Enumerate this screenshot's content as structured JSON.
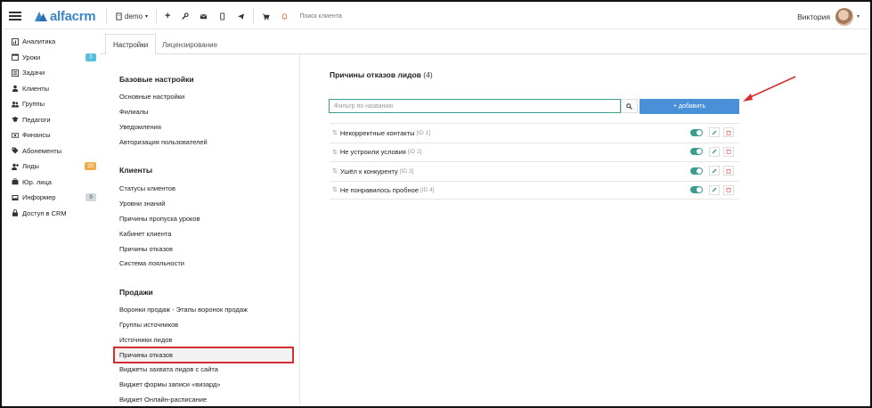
{
  "topbar": {
    "logo_text": "alfacrm",
    "branch_label": "demo",
    "search_placeholder": "Поиск клиента",
    "user_name": "Виктория",
    "colors": {
      "brand": "#3a86c8",
      "bell": "#e8674b"
    }
  },
  "sidebar": {
    "items": [
      {
        "label": "Аналитика",
        "icon": "analytics-icon"
      },
      {
        "label": "Уроки",
        "icon": "calendar-icon",
        "badge": "1",
        "badge_color": "#5bc0de"
      },
      {
        "label": "Задачи",
        "icon": "tasks-icon"
      },
      {
        "label": "Клиенты",
        "icon": "user-icon"
      },
      {
        "label": "Группы",
        "icon": "group-icon"
      },
      {
        "label": "Педагоги",
        "icon": "graduation-cap-icon"
      },
      {
        "label": "Финансы",
        "icon": "money-icon"
      },
      {
        "label": "Абонементы",
        "icon": "tag-icon"
      },
      {
        "label": "Лиды",
        "icon": "user-plus-icon",
        "badge": "20",
        "badge_color": "#f0ad4e"
      },
      {
        "label": "Юр. лица",
        "icon": "briefcase-icon"
      },
      {
        "label": "Информер",
        "icon": "inbox-icon",
        "badge": "9",
        "badge_color": "#cfd8dc"
      },
      {
        "label": "Доступ в CRM",
        "icon": "lock-icon"
      }
    ]
  },
  "tabs": [
    {
      "label": "Настройки",
      "active": true
    },
    {
      "label": "Лицензирование",
      "active": false
    }
  ],
  "settings": {
    "sections": [
      {
        "title": "Базовые настройки",
        "links": [
          "Основные настройки",
          "Филиалы",
          "Уведомления",
          "Авторизация пользователей"
        ]
      },
      {
        "title": "Клиенты",
        "links": [
          "Статусы клиентов",
          "Уровни знаний",
          "Причины пропуска уроков",
          "Кабинет клиента",
          "Причины отказов",
          "Система лояльности"
        ]
      },
      {
        "title": "Продажи",
        "links": [
          "Воронки продаж - Этапы воронок продаж",
          "Группы источников",
          "Источники лидов",
          "Причины отказов",
          "Виджеты захвата лидов с сайта",
          "Виджет формы записи «визард»",
          "Виджет Онлайн-расписание"
        ]
      }
    ]
  },
  "main": {
    "title": "Причины отказов лидов",
    "count": "(4)",
    "filter_placeholder": "Фильтр по названию",
    "add_button": "+ добавить",
    "rows": [
      {
        "name": "Некорректные контакты",
        "id": "[ID 1]"
      },
      {
        "name": "Не устроили условия",
        "id": "[ID 2]"
      },
      {
        "name": "Ушёл к конкуренту",
        "id": "[ID 3]"
      },
      {
        "name": "Не понравилось пробное",
        "id": "[ID 4]"
      }
    ],
    "colors": {
      "accent": "#3a9d8f",
      "add_button": "#4a90d9",
      "delete": "#e57373",
      "annotation": "#d32f2f"
    }
  }
}
